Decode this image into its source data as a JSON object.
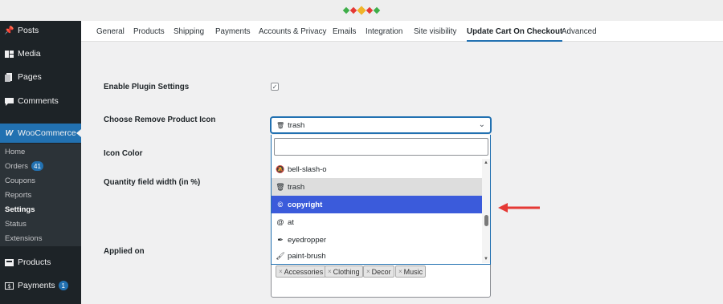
{
  "colors": {
    "sidebar_bg": "#1d2327",
    "accent": "#2271b1",
    "highlight": "#3b5bdb",
    "arrow": "#e53935",
    "dot_green": "#3fae49",
    "dot_red": "#e53935",
    "dot_yellow": "#f0b429"
  },
  "sidebar": {
    "items": [
      {
        "label": "Posts",
        "icon": "pin-icon"
      },
      {
        "label": "Media",
        "icon": "media-icon"
      },
      {
        "label": "Pages",
        "icon": "pages-icon"
      },
      {
        "label": "Comments",
        "icon": "comment-icon"
      },
      {
        "label": "WooCommerce",
        "icon": "woocommerce-icon"
      },
      {
        "label": "Products",
        "icon": "products-icon"
      },
      {
        "label": "Payments",
        "icon": "payments-icon",
        "badge": "1"
      }
    ],
    "submenu": [
      {
        "label": "Home"
      },
      {
        "label": "Orders",
        "badge": "41"
      },
      {
        "label": "Coupons"
      },
      {
        "label": "Reports"
      },
      {
        "label": "Settings"
      },
      {
        "label": "Status"
      },
      {
        "label": "Extensions"
      }
    ]
  },
  "tabs": [
    {
      "label": "General"
    },
    {
      "label": "Products"
    },
    {
      "label": "Shipping"
    },
    {
      "label": "Payments"
    },
    {
      "label": "Accounts & Privacy"
    },
    {
      "label": "Emails"
    },
    {
      "label": "Integration"
    },
    {
      "label": "Site visibility"
    },
    {
      "label": "Update Cart On Checkout"
    },
    {
      "label": "Advanced"
    }
  ],
  "form": {
    "enable_label": "Enable Plugin Settings",
    "enable_checked": "✓",
    "icon_label": "Choose Remove Product Icon",
    "icon_value": "trash",
    "color_label": "Icon Color",
    "width_label": "Quantity field width (in %)",
    "applied_label": "Applied on",
    "search_value": "",
    "options": [
      {
        "label": "bell-slash-o",
        "icon": "bell-slash-icon"
      },
      {
        "label": "trash",
        "icon": "trash-icon"
      },
      {
        "label": "copyright",
        "icon": "copyright-icon"
      },
      {
        "label": "at",
        "icon": "at-icon"
      },
      {
        "label": "eyedropper",
        "icon": "eyedropper-icon"
      },
      {
        "label": "paint-brush",
        "icon": "paint-brush-icon"
      }
    ],
    "selected_option": "trash",
    "highlighted_option": "copyright",
    "chips": [
      {
        "label": "Accessories",
        "remove": "×"
      },
      {
        "label": "Clothing",
        "remove": "×"
      },
      {
        "label": "Decor",
        "remove": "×"
      },
      {
        "label": "Music",
        "remove": "×"
      }
    ]
  }
}
